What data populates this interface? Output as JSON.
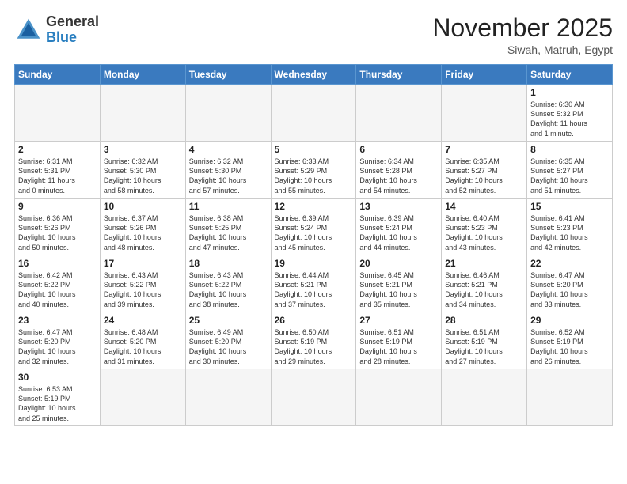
{
  "header": {
    "logo_general": "General",
    "logo_blue": "Blue",
    "month_title": "November 2025",
    "location": "Siwah, Matruh, Egypt"
  },
  "weekdays": [
    "Sunday",
    "Monday",
    "Tuesday",
    "Wednesday",
    "Thursday",
    "Friday",
    "Saturday"
  ],
  "weeks": [
    [
      {
        "day": "",
        "info": ""
      },
      {
        "day": "",
        "info": ""
      },
      {
        "day": "",
        "info": ""
      },
      {
        "day": "",
        "info": ""
      },
      {
        "day": "",
        "info": ""
      },
      {
        "day": "",
        "info": ""
      },
      {
        "day": "1",
        "info": "Sunrise: 6:30 AM\nSunset: 5:32 PM\nDaylight: 11 hours\nand 1 minute."
      }
    ],
    [
      {
        "day": "2",
        "info": "Sunrise: 6:31 AM\nSunset: 5:31 PM\nDaylight: 11 hours\nand 0 minutes."
      },
      {
        "day": "3",
        "info": "Sunrise: 6:32 AM\nSunset: 5:30 PM\nDaylight: 10 hours\nand 58 minutes."
      },
      {
        "day": "4",
        "info": "Sunrise: 6:32 AM\nSunset: 5:30 PM\nDaylight: 10 hours\nand 57 minutes."
      },
      {
        "day": "5",
        "info": "Sunrise: 6:33 AM\nSunset: 5:29 PM\nDaylight: 10 hours\nand 55 minutes."
      },
      {
        "day": "6",
        "info": "Sunrise: 6:34 AM\nSunset: 5:28 PM\nDaylight: 10 hours\nand 54 minutes."
      },
      {
        "day": "7",
        "info": "Sunrise: 6:35 AM\nSunset: 5:27 PM\nDaylight: 10 hours\nand 52 minutes."
      },
      {
        "day": "8",
        "info": "Sunrise: 6:35 AM\nSunset: 5:27 PM\nDaylight: 10 hours\nand 51 minutes."
      }
    ],
    [
      {
        "day": "9",
        "info": "Sunrise: 6:36 AM\nSunset: 5:26 PM\nDaylight: 10 hours\nand 50 minutes."
      },
      {
        "day": "10",
        "info": "Sunrise: 6:37 AM\nSunset: 5:26 PM\nDaylight: 10 hours\nand 48 minutes."
      },
      {
        "day": "11",
        "info": "Sunrise: 6:38 AM\nSunset: 5:25 PM\nDaylight: 10 hours\nand 47 minutes."
      },
      {
        "day": "12",
        "info": "Sunrise: 6:39 AM\nSunset: 5:24 PM\nDaylight: 10 hours\nand 45 minutes."
      },
      {
        "day": "13",
        "info": "Sunrise: 6:39 AM\nSunset: 5:24 PM\nDaylight: 10 hours\nand 44 minutes."
      },
      {
        "day": "14",
        "info": "Sunrise: 6:40 AM\nSunset: 5:23 PM\nDaylight: 10 hours\nand 43 minutes."
      },
      {
        "day": "15",
        "info": "Sunrise: 6:41 AM\nSunset: 5:23 PM\nDaylight: 10 hours\nand 42 minutes."
      }
    ],
    [
      {
        "day": "16",
        "info": "Sunrise: 6:42 AM\nSunset: 5:22 PM\nDaylight: 10 hours\nand 40 minutes."
      },
      {
        "day": "17",
        "info": "Sunrise: 6:43 AM\nSunset: 5:22 PM\nDaylight: 10 hours\nand 39 minutes."
      },
      {
        "day": "18",
        "info": "Sunrise: 6:43 AM\nSunset: 5:22 PM\nDaylight: 10 hours\nand 38 minutes."
      },
      {
        "day": "19",
        "info": "Sunrise: 6:44 AM\nSunset: 5:21 PM\nDaylight: 10 hours\nand 37 minutes."
      },
      {
        "day": "20",
        "info": "Sunrise: 6:45 AM\nSunset: 5:21 PM\nDaylight: 10 hours\nand 35 minutes."
      },
      {
        "day": "21",
        "info": "Sunrise: 6:46 AM\nSunset: 5:21 PM\nDaylight: 10 hours\nand 34 minutes."
      },
      {
        "day": "22",
        "info": "Sunrise: 6:47 AM\nSunset: 5:20 PM\nDaylight: 10 hours\nand 33 minutes."
      }
    ],
    [
      {
        "day": "23",
        "info": "Sunrise: 6:47 AM\nSunset: 5:20 PM\nDaylight: 10 hours\nand 32 minutes."
      },
      {
        "day": "24",
        "info": "Sunrise: 6:48 AM\nSunset: 5:20 PM\nDaylight: 10 hours\nand 31 minutes."
      },
      {
        "day": "25",
        "info": "Sunrise: 6:49 AM\nSunset: 5:20 PM\nDaylight: 10 hours\nand 30 minutes."
      },
      {
        "day": "26",
        "info": "Sunrise: 6:50 AM\nSunset: 5:19 PM\nDaylight: 10 hours\nand 29 minutes."
      },
      {
        "day": "27",
        "info": "Sunrise: 6:51 AM\nSunset: 5:19 PM\nDaylight: 10 hours\nand 28 minutes."
      },
      {
        "day": "28",
        "info": "Sunrise: 6:51 AM\nSunset: 5:19 PM\nDaylight: 10 hours\nand 27 minutes."
      },
      {
        "day": "29",
        "info": "Sunrise: 6:52 AM\nSunset: 5:19 PM\nDaylight: 10 hours\nand 26 minutes."
      }
    ],
    [
      {
        "day": "30",
        "info": "Sunrise: 6:53 AM\nSunset: 5:19 PM\nDaylight: 10 hours\nand 25 minutes."
      },
      {
        "day": "",
        "info": ""
      },
      {
        "day": "",
        "info": ""
      },
      {
        "day": "",
        "info": ""
      },
      {
        "day": "",
        "info": ""
      },
      {
        "day": "",
        "info": ""
      },
      {
        "day": "",
        "info": ""
      }
    ]
  ]
}
